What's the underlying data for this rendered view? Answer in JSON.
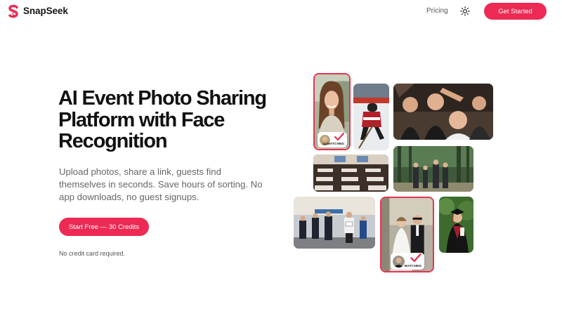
{
  "header": {
    "brand": "SnapSeek",
    "nav_pricing": "Pricing",
    "cta_label": "Get Started",
    "theme_icon": "sun-icon"
  },
  "hero": {
    "title": "AI Event Photo Sharing Platform with Face Recognition",
    "subtitle": "Upload photos, share a link, guests find themselves in seconds. Save hours of sorting. No app downloads, no guest signups.",
    "cta_label": "Start Free — 30 Credits",
    "note": "No credit card required."
  },
  "collage": {
    "matched_label": "MATCHED",
    "photos": [
      "portrait-woman",
      "hockey-player",
      "party-crowd",
      "conference-room",
      "forest-group",
      "marathon-runners",
      "wedding-couple",
      "graduate"
    ]
  },
  "colors": {
    "accent": "#ec2a53",
    "highlight_border": "#e8334f",
    "check": "#e8334f"
  }
}
